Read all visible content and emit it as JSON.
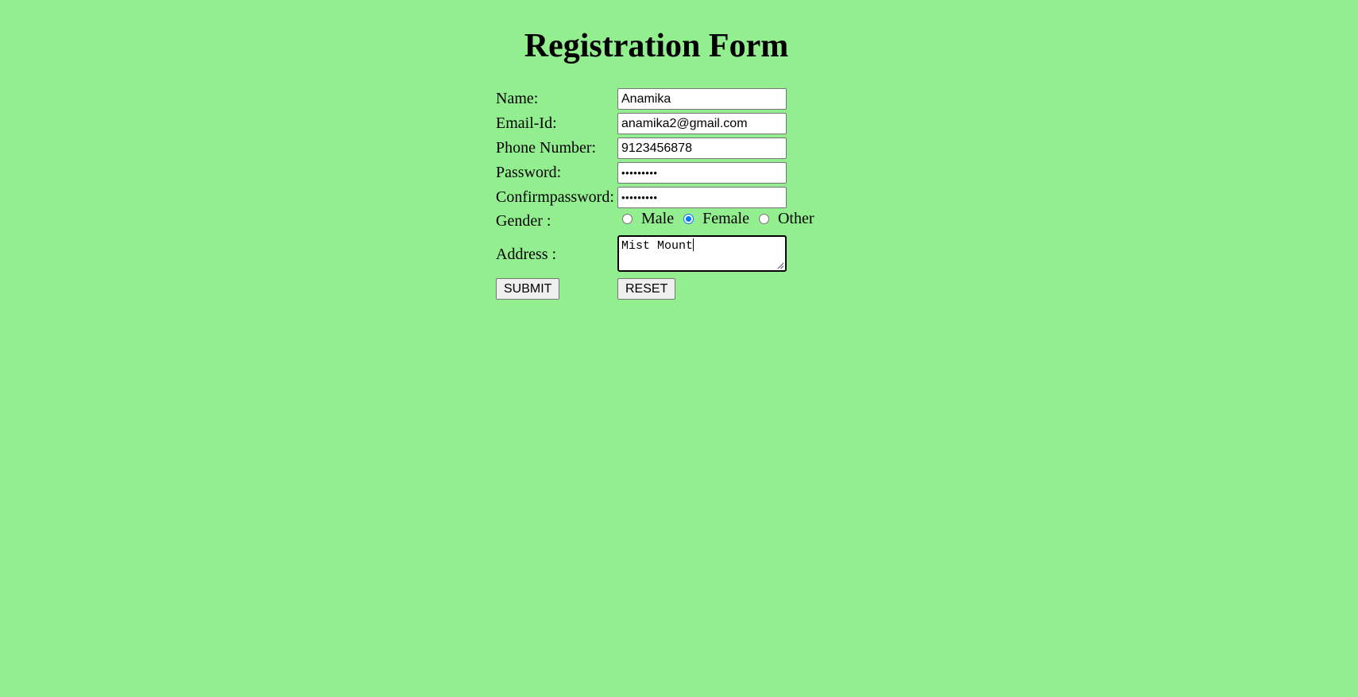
{
  "page": {
    "title": "Registration Form",
    "background": "#93ee90"
  },
  "form": {
    "fields": [
      {
        "label": "Name:",
        "value": "Anamika"
      },
      {
        "label": "Email-Id:",
        "value": "anamika2@gmail.com"
      },
      {
        "label": "Phone Number:",
        "value": "9123456878"
      },
      {
        "label": "Password:",
        "value": "•••••••••"
      },
      {
        "label": "Confirmpassword:",
        "value": "•••••••••"
      }
    ],
    "gender": {
      "label": "Gender :",
      "options": [
        "Male",
        "Female",
        "Other"
      ],
      "selected": "Female"
    },
    "address": {
      "label": "Address :",
      "value": "Mist Mount"
    },
    "buttons": {
      "submit": "SUBMIT",
      "reset": "RESET"
    }
  },
  "colors": {
    "radio_checked": "#0075ff",
    "button_bg": "#efefef"
  }
}
